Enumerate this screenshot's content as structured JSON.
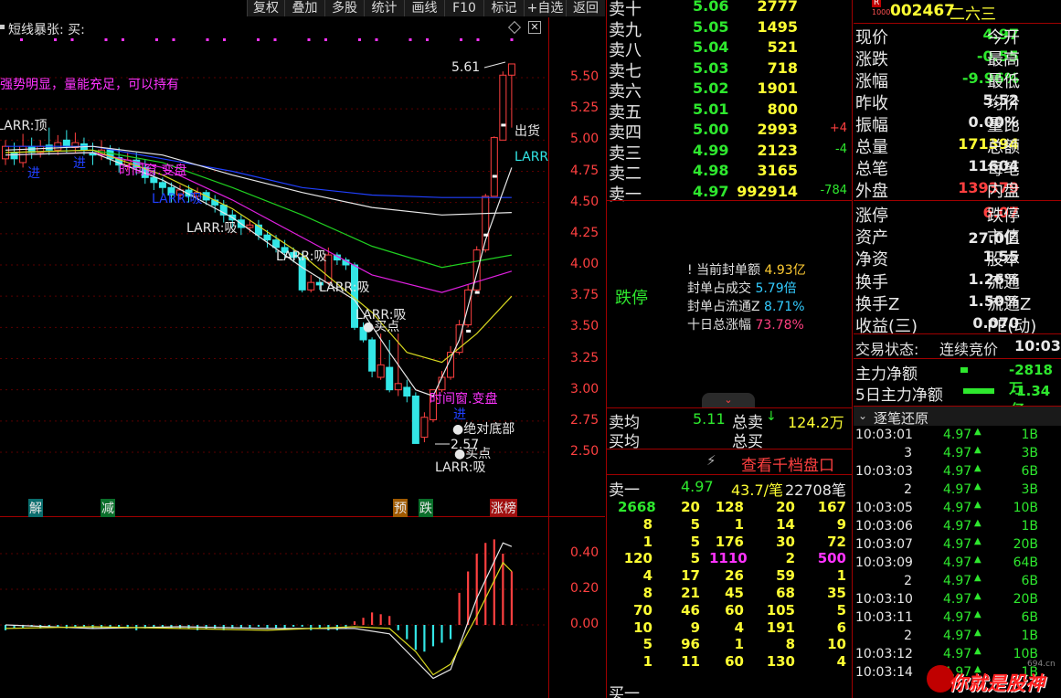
{
  "toolbar": [
    "复权",
    "叠加",
    "多股",
    "统计",
    "画线",
    "F10",
    "标记",
    "+自选",
    "返回"
  ],
  "chart": {
    "indicator_name": "短线暴张: 买:",
    "signal_text": "强势明显，量能充足，可以持有",
    "price_ticks": [
      "5.50",
      "5.25",
      "5.00",
      "4.75",
      "4.50",
      "4.25",
      "4.00",
      "3.75",
      "3.50",
      "3.25",
      "3.00",
      "2.75",
      "2.50"
    ],
    "osc_ticks": [
      "0.40",
      "0.20",
      "0.00"
    ],
    "annotations": {
      "high": "5.61",
      "low": "2.57",
      "sell": "出货",
      "larr_right": "LARR",
      "larr_top": "LARR:顶",
      "jin": "进",
      "shi_jian": "时间窗.变盘",
      "shi_jian2": "时间窗.变盘",
      "larr_xi1": "LARR:吸",
      "larr_xi2": "LARR:吸",
      "larr_xi3": "LARR:吸",
      "larr_xi4": "LARR:吸",
      "larr_xi5": "LARR:吸",
      "larr_xi6": "LARR:吸",
      "buy1": "买点",
      "buy2": "买点",
      "jin2": "进",
      "bottom": "绝对底部"
    },
    "bottom_labels": {
      "jie": "解",
      "jian": "减",
      "yu": "预",
      "die": "跌",
      "zhang": "涨榜"
    }
  },
  "stock": {
    "flag": "R",
    "sub": "1000",
    "code": "002467",
    "name": "二六三"
  },
  "order_book": {
    "sells": [
      {
        "label": "卖十",
        "price": "5.06",
        "vol": "2777",
        "chg": ""
      },
      {
        "label": "卖九",
        "price": "5.05",
        "vol": "1495",
        "chg": ""
      },
      {
        "label": "卖八",
        "price": "5.04",
        "vol": "521",
        "chg": ""
      },
      {
        "label": "卖七",
        "price": "5.03",
        "vol": "718",
        "chg": ""
      },
      {
        "label": "卖六",
        "price": "5.02",
        "vol": "1901",
        "chg": ""
      },
      {
        "label": "卖五",
        "price": "5.01",
        "vol": "800",
        "chg": ""
      },
      {
        "label": "卖四",
        "price": "5.00",
        "vol": "2993",
        "chg": "+4"
      },
      {
        "label": "卖三",
        "price": "4.99",
        "vol": "2123",
        "chg": "-4"
      },
      {
        "label": "卖二",
        "price": "4.98",
        "vol": "3165",
        "chg": ""
      },
      {
        "label": "卖一",
        "price": "4.97",
        "vol": "992914",
        "chg": "-784"
      }
    ],
    "limit_label": "跌停",
    "limit_info": [
      {
        "k": "当前封单额",
        "v": "4.93亿"
      },
      {
        "k": "封单占成交",
        "v": "5.79倍"
      },
      {
        "k": "封单占流通Z",
        "v": "8.71%"
      },
      {
        "k": "十日总涨幅",
        "v": "73.78%"
      }
    ],
    "avg_sell_label": "卖均",
    "avg_sell": "5.11",
    "total_sell_label": "总卖",
    "total_sell": "124.2万",
    "avg_buy_label": "买均",
    "total_buy_label": "总买",
    "thousand_btn": "查看千档盘口",
    "sell1_label": "卖一",
    "sell1_price": "4.97",
    "sell1_lots": "43.7/笔",
    "sell1_count": "22708笔",
    "queue": [
      [
        "2668",
        "20",
        "128",
        "20",
        "167"
      ],
      [
        "8",
        "5",
        "1",
        "14",
        "9"
      ],
      [
        "1",
        "5",
        "176",
        "30",
        "72"
      ],
      [
        "120",
        "5",
        "1110",
        "2",
        "500"
      ],
      [
        "4",
        "17",
        "26",
        "59",
        "1"
      ],
      [
        "8",
        "21",
        "45",
        "68",
        "35"
      ],
      [
        "70",
        "46",
        "60",
        "105",
        "5"
      ],
      [
        "10",
        "9",
        "4",
        "191",
        "6"
      ],
      [
        "5",
        "96",
        "1",
        "8",
        "10"
      ],
      [
        "1",
        "11",
        "60",
        "130",
        "4"
      ]
    ],
    "buy1_label": "买一"
  },
  "quote": [
    {
      "k1": "现价",
      "v1": "4.97",
      "k2": "今开",
      "c": "grn"
    },
    {
      "k1": "涨跌",
      "v1": "-0.55",
      "k2": "最高",
      "c": "grn"
    },
    {
      "k1": "涨幅",
      "v1": "-9.96%",
      "k2": "最低",
      "c": "grn"
    },
    {
      "k1": "昨收",
      "v1": "5.52",
      "k2": "均价",
      "c": "wht"
    },
    {
      "k1": "振幅",
      "v1": "0.00%",
      "k2": "量比",
      "c": "wht"
    },
    {
      "k1": "总量",
      "v1": "171394",
      "k2": "总额",
      "c": "yel"
    },
    {
      "k1": "总笔",
      "v1": "11604",
      "k2": "每笔",
      "c": "wht"
    },
    {
      "k1": "外盘",
      "v1": "139379",
      "k2": "内盘",
      "c": "red"
    }
  ],
  "quote2": [
    {
      "k1": "涨停",
      "v1": "6.07",
      "k2": "跌停",
      "c": "red"
    },
    {
      "k1": "资产",
      "v1": "27.0亿",
      "k2": "市值",
      "c": "wht"
    },
    {
      "k1": "净资",
      "v1": "1.55",
      "k2": "股本",
      "c": "wht"
    },
    {
      "k1": "换手",
      "v1": "1.26%",
      "k2": "流通",
      "c": "wht"
    },
    {
      "k1": "换手Z",
      "v1": "1.50%",
      "k2": "流通Z",
      "c": "wht"
    },
    {
      "k1": "收益(三)",
      "v1": "0.070",
      "k2": "PE(动)",
      "c": "wht"
    }
  ],
  "status": {
    "label": "交易状态:",
    "value": "连续竞价",
    "time": "10:03:"
  },
  "flows": [
    {
      "label": "主力净额",
      "value": "-2818万"
    },
    {
      "label": "5日主力净额",
      "value": "-1.34亿"
    }
  ],
  "ticks_title": "逐笔还原",
  "ticks": [
    [
      "10:03:01",
      "4.97",
      "1B"
    ],
    [
      "3",
      "4.97",
      "3B"
    ],
    [
      "10:03:03",
      "4.97",
      "6B"
    ],
    [
      "2",
      "4.97",
      "3B"
    ],
    [
      "10:03:05",
      "4.97",
      "10B"
    ],
    [
      "10:03:06",
      "4.97",
      "1B"
    ],
    [
      "10:03:07",
      "4.97",
      "20B"
    ],
    [
      "10:03:09",
      "4.97",
      "64B"
    ],
    [
      "2",
      "4.97",
      "6B"
    ],
    [
      "10:03:10",
      "4.97",
      "20B"
    ],
    [
      "10:03:11",
      "4.97",
      "6B"
    ],
    [
      "2",
      "4.97",
      "1B"
    ],
    [
      "10:03:12",
      "4.97",
      "10B"
    ],
    [
      "10:03:14",
      "4.97",
      "1B"
    ]
  ],
  "watermark": "你就是股神",
  "watermark_url": "694.cn"
}
